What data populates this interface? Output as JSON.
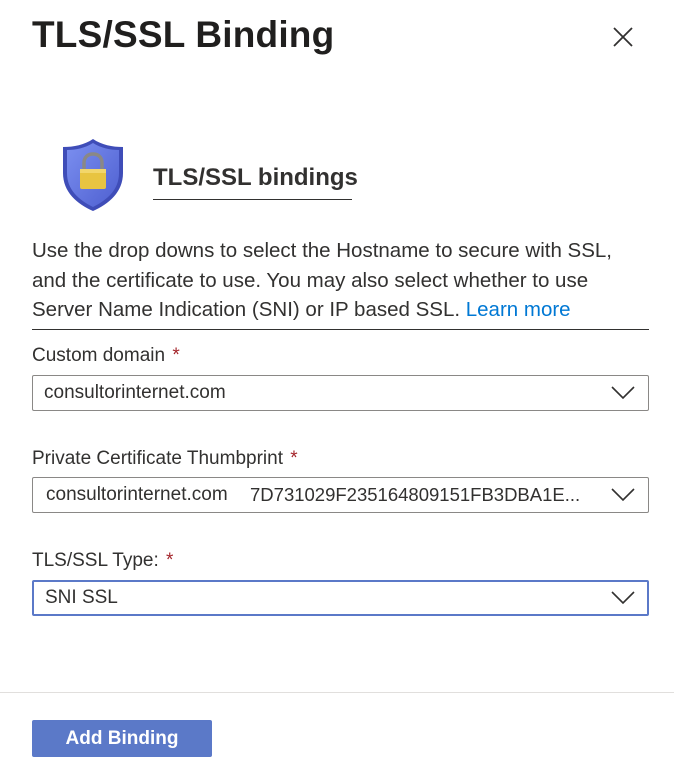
{
  "panel": {
    "title": "TLS/SSL Binding",
    "close_icon": "close-icon"
  },
  "section": {
    "icon": "shield-lock-icon",
    "heading": "TLS/SSL bindings",
    "description": "Use the drop downs to select the Hostname to secure with SSL, and the certificate to use. You may also select whether to use Server Name Indication (SNI) or IP based SSL.",
    "learn_more": "Learn more"
  },
  "form": {
    "custom_domain": {
      "label": "Custom domain",
      "required_mark": "*",
      "value": "consultorinternet.com"
    },
    "certificate": {
      "label": "Private Certificate Thumbprint",
      "required_mark": "*",
      "value_name": "consultorinternet.com",
      "value_thumbprint": "7D731029F235164809151FB3DBA1E..."
    },
    "ssl_type": {
      "label": "TLS/SSL Type:",
      "required_mark": "*",
      "value": "SNI SSL"
    }
  },
  "footer": {
    "add_button": "Add Binding"
  },
  "colors": {
    "primary": "#5b79c8",
    "link": "#0078d4",
    "required": "#a4262c",
    "shield": "#5b6ee1",
    "lock": "#e8c441"
  }
}
